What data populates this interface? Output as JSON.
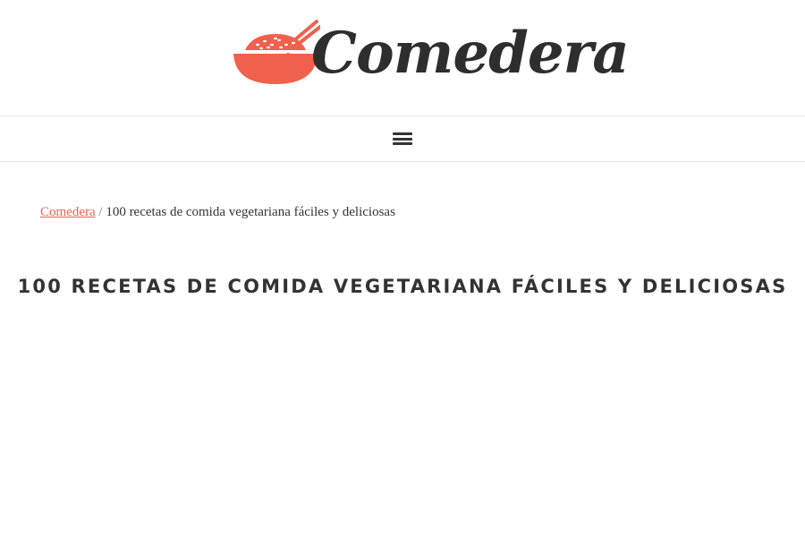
{
  "site": {
    "name": "Comedera",
    "logo_icon": "rice-bowl-chopsticks-icon",
    "logo_color": "#f0614d",
    "text_color": "#2e2e2e"
  },
  "nav": {
    "menu_icon": "hamburger-menu-icon"
  },
  "breadcrumb": {
    "home_label": "Comedera",
    "separator": "/",
    "current": "100 recetas de comida vegetariana fáciles y deliciosas",
    "link_color": "#f0614d"
  },
  "page": {
    "title": "100 RECETAS DE COMIDA VEGETARIANA FÁCILES Y DELICIOSAS"
  }
}
